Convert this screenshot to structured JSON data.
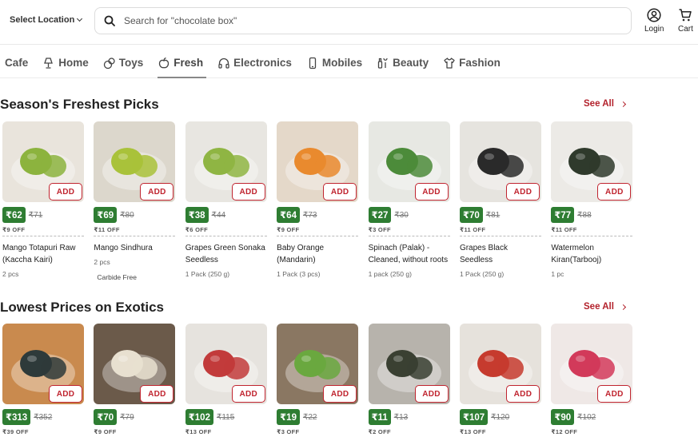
{
  "header": {
    "location_label": "Select Location",
    "search_placeholder": "Search for \"chocolate box\"",
    "login_label": "Login",
    "cart_label": "Cart"
  },
  "categories": [
    {
      "label": "Cafe",
      "icon": "none"
    },
    {
      "label": "Home",
      "icon": "lamp-icon"
    },
    {
      "label": "Toys",
      "icon": "toy-icon"
    },
    {
      "label": "Fresh",
      "icon": "apple-icon",
      "active": true
    },
    {
      "label": "Electronics",
      "icon": "headphones-icon"
    },
    {
      "label": "Mobiles",
      "icon": "phone-icon"
    },
    {
      "label": "Beauty",
      "icon": "beauty-icon"
    },
    {
      "label": "Fashion",
      "icon": "shirt-icon"
    }
  ],
  "sections": [
    {
      "title": "Season's Freshest Picks",
      "see_all": "See All",
      "products": [
        {
          "price": "₹62",
          "mrp": "₹71",
          "off": "₹9 OFF",
          "name": "Mango Totapuri Raw (Kaccha Kairi)",
          "qty": "2 pcs",
          "tag": "",
          "bg": "#e9e4dc",
          "fg": "#8cb33e"
        },
        {
          "price": "₹69",
          "mrp": "₹80",
          "off": "₹11 OFF",
          "name": "Mango Sindhura",
          "qty": "2 pcs",
          "tag": "Carbide Free",
          "bg": "#dcd7cc",
          "fg": "#a9c23a"
        },
        {
          "price": "₹38",
          "mrp": "₹44",
          "off": "₹6 OFF",
          "name": "Grapes Green Sonaka Seedless",
          "qty": "1 Pack (250 g)",
          "tag": "",
          "bg": "#e8e6e1",
          "fg": "#8fb543"
        },
        {
          "price": "₹64",
          "mrp": "₹73",
          "off": "₹9 OFF",
          "name": "Baby Orange (Mandarin)",
          "qty": "1 Pack (3 pcs)",
          "tag": "",
          "bg": "#e4d8c9",
          "fg": "#e98a2e"
        },
        {
          "price": "₹27",
          "mrp": "₹30",
          "off": "₹3 OFF",
          "name": "Spinach (Palak) - Cleaned, without roots",
          "qty": "1 pack (250 g)",
          "tag": "",
          "bg": "#e7e8e3",
          "fg": "#4c8b3a"
        },
        {
          "price": "₹70",
          "mrp": "₹81",
          "off": "₹11 OFF",
          "name": "Grapes Black Seedless",
          "qty": "1 Pack (250 g)",
          "tag": "",
          "bg": "#e6e4df",
          "fg": "#2a2a2a"
        },
        {
          "price": "₹77",
          "mrp": "₹88",
          "off": "₹11 OFF",
          "name": "Watermelon Kiran(Tarbooj)",
          "qty": "1 pc",
          "tag": "",
          "bg": "#eceae6",
          "fg": "#2f3a2c"
        }
      ]
    },
    {
      "title": "Lowest Prices on Exotics",
      "see_all": "See All",
      "products": [
        {
          "price": "₹313",
          "mrp": "₹352",
          "off": "₹39 OFF",
          "name": "",
          "qty": "",
          "tag": "",
          "bg": "#c98a4e",
          "fg": "#2e3a3a"
        },
        {
          "price": "₹70",
          "mrp": "₹79",
          "off": "₹9 OFF",
          "name": "",
          "qty": "",
          "tag": "",
          "bg": "#6b5a4a",
          "fg": "#e8e0d0"
        },
        {
          "price": "₹102",
          "mrp": "₹115",
          "off": "₹13 OFF",
          "name": "",
          "qty": "",
          "tag": "",
          "bg": "#e6e3de",
          "fg": "#c23b3b"
        },
        {
          "price": "₹19",
          "mrp": "₹22",
          "off": "₹3 OFF",
          "name": "",
          "qty": "",
          "tag": "",
          "bg": "#8a7762",
          "fg": "#6aa83f"
        },
        {
          "price": "₹11",
          "mrp": "₹13",
          "off": "₹2 OFF",
          "name": "",
          "qty": "",
          "tag": "",
          "bg": "#b7b3ac",
          "fg": "#3a4032"
        },
        {
          "price": "₹107",
          "mrp": "₹120",
          "off": "₹13 OFF",
          "name": "",
          "qty": "",
          "tag": "",
          "bg": "#e6e2dc",
          "fg": "#c63b2e"
        },
        {
          "price": "₹90",
          "mrp": "₹102",
          "off": "₹12 OFF",
          "name": "",
          "qty": "",
          "tag": "",
          "bg": "#efe8e6",
          "fg": "#d23a5a"
        }
      ]
    }
  ],
  "add_label": "ADD",
  "colors": {
    "accent": "#c0242f",
    "price_badge": "#2e7d32"
  }
}
